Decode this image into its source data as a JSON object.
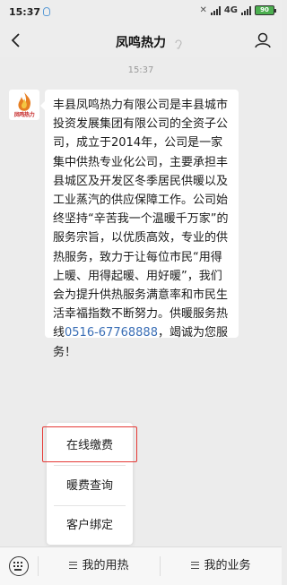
{
  "status_bar": {
    "time": "15:37",
    "network": "4G",
    "battery": "90"
  },
  "header": {
    "title": "凤鸣热力",
    "back_icon": "back-arrow-icon",
    "profile_icon": "person-icon"
  },
  "chat": {
    "timestamp": "15:37",
    "avatar_logo_text": "凤鸣热力",
    "message_text": "丰县凤鸣热力有限公司是丰县城市投资发展集团有限公司的全资子公司，成立于2014年，公司是一家集中供热专业化公司，主要承担丰县城区及开发区冬季居民供暖以及工业蒸汽的供应保障工作。公司始终坚持“辛苦我一个温暖千万家”的服务宗旨，以优质高效，专业的供热服务，致力于让每位市民“用得上暖、用得起暖、用好暖”，我们会为提升供热服务满意率和市民生活幸福指数不断努力。供暖服务热线",
    "message_phone": "0516-67768888",
    "message_end": "，竭诚为您服务！"
  },
  "popup_menu": {
    "items": [
      {
        "label": "在线缴费"
      },
      {
        "label": "暖费查询"
      },
      {
        "label": "客户绑定"
      }
    ],
    "highlight_color": "#e53935"
  },
  "bottom_bar": {
    "keyboard_icon": "keyboard-icon",
    "tabs": [
      {
        "label": "我的用热"
      },
      {
        "label": "我的业务"
      }
    ]
  }
}
